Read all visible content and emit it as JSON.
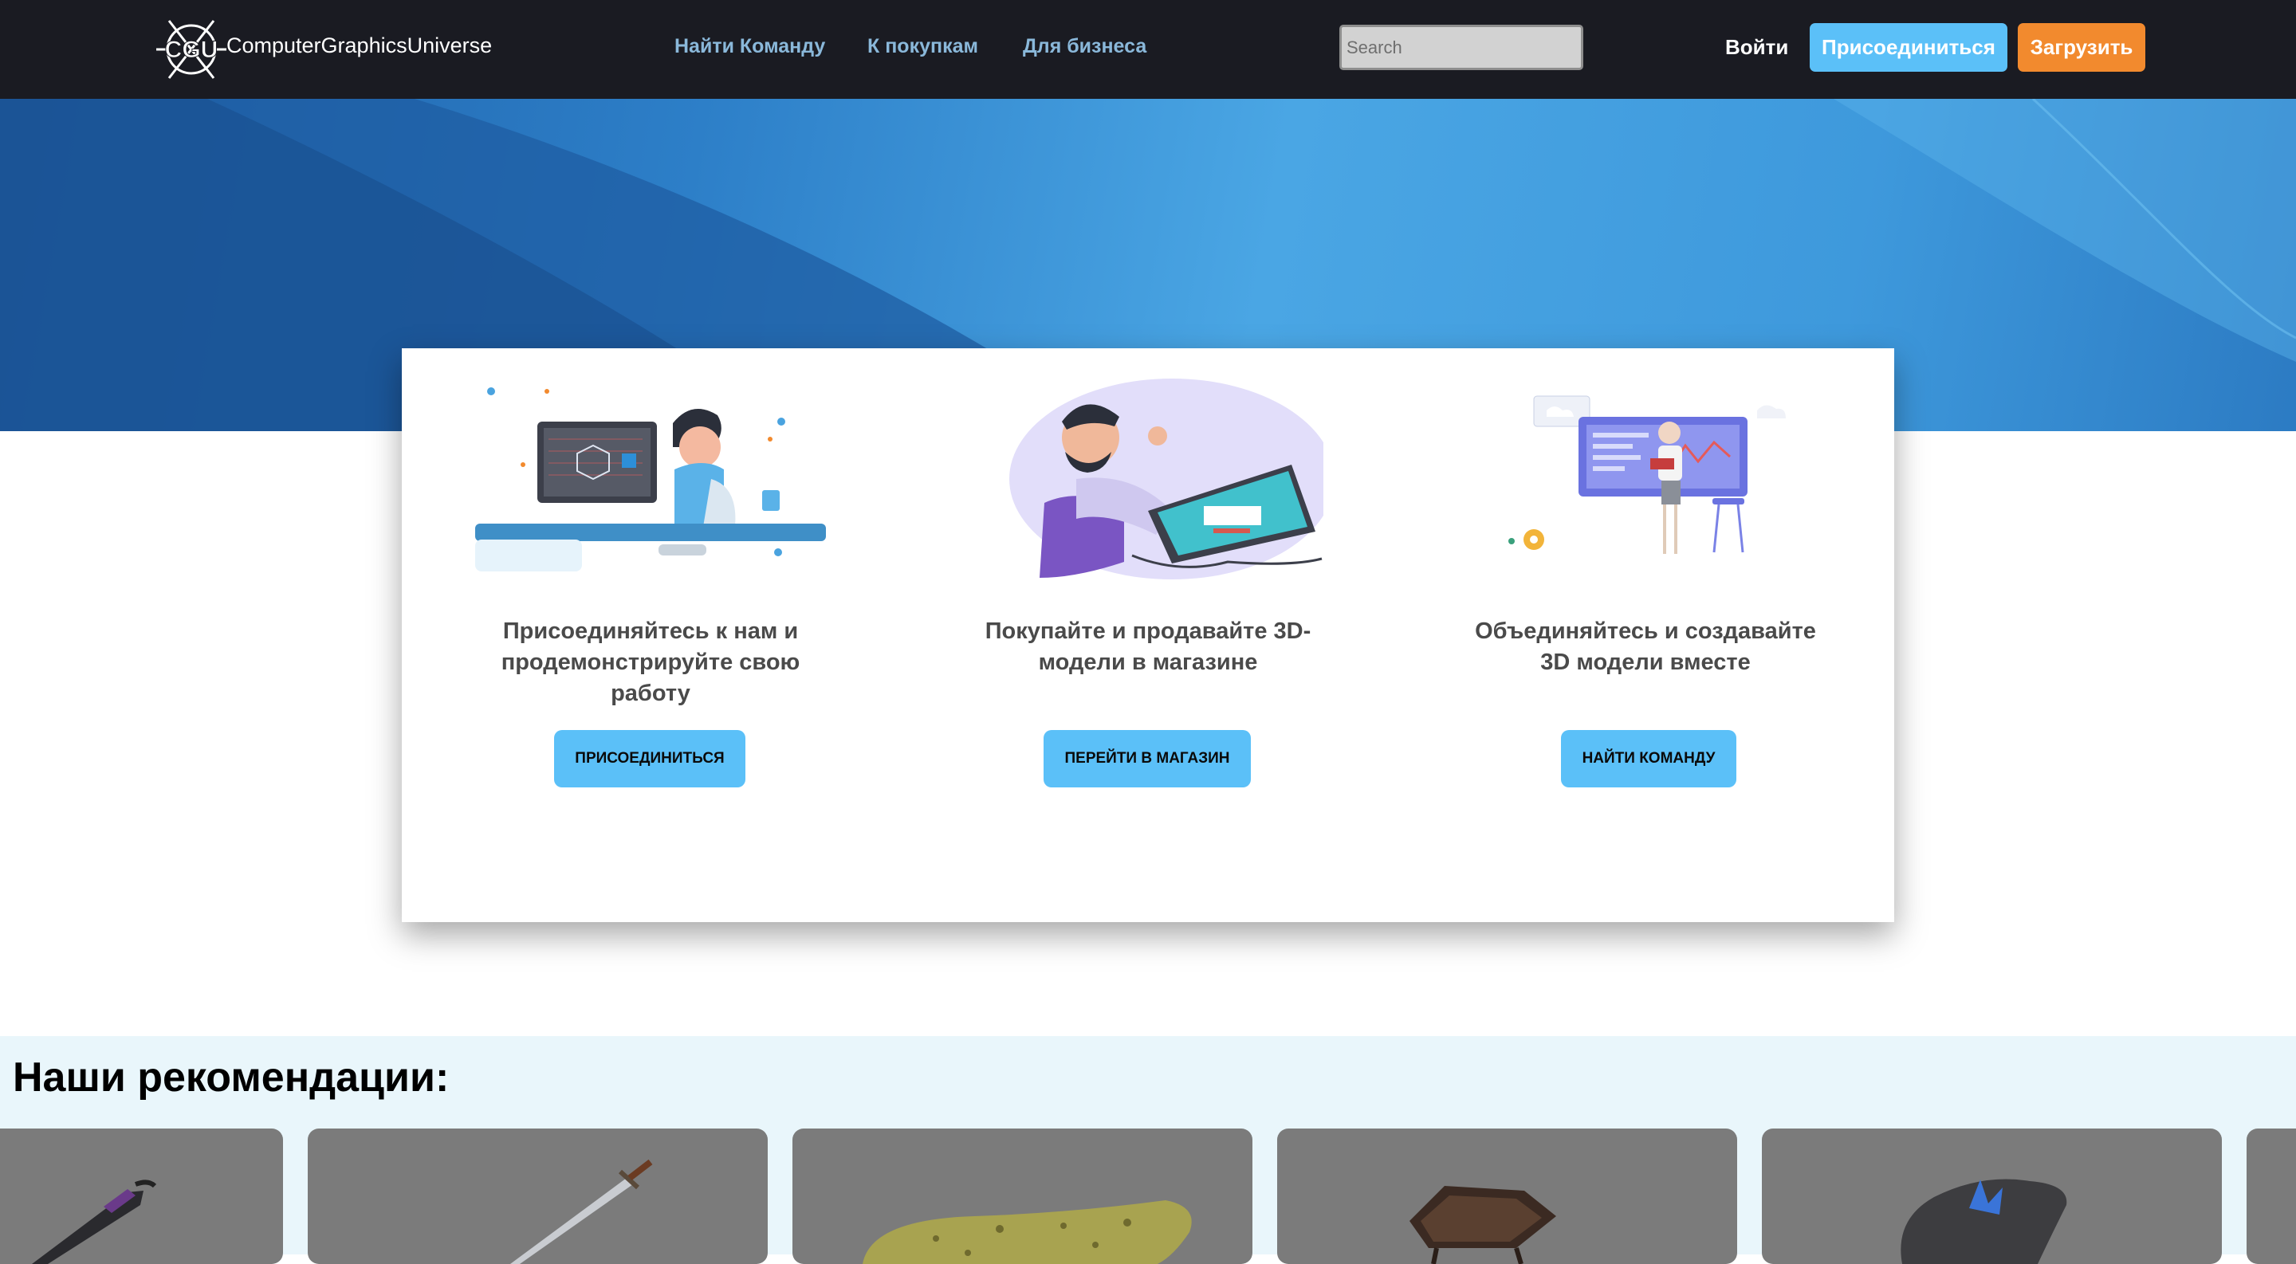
{
  "navbar": {
    "logo_text": "CGU",
    "brand": "ComputerGraphicsUniverse",
    "links": [
      "Найти Команду",
      "К покупкам",
      "Для бизнеса"
    ],
    "search_placeholder": "Search",
    "login": "Войти",
    "join": "Присоединиться",
    "upload": "Загрузить"
  },
  "features": [
    {
      "text": "Присоединяйтесь к нам и продемонстрируйте свою работу",
      "button": "ПРИСОЕДИНИТЬСЯ",
      "illustration": "person-at-computer-illustration"
    },
    {
      "text": "Покупайте и продавайте 3D-модели в магазине",
      "button": "ПЕРЕЙТИ В МАГАЗИН",
      "illustration": "man-with-tablet-illustration"
    },
    {
      "text": "Объединяйтесь и создавайте 3D модели вместе",
      "button": "НАЙТИ КОМАНДУ",
      "illustration": "team-dashboard-illustration"
    }
  ],
  "recommendations": {
    "title": "Наши рекомендации:",
    "items": [
      "dark-sword-model",
      "longsword-model",
      "pickle-model",
      "wheelbarrow-model",
      "crystal-rock-model"
    ]
  },
  "colors": {
    "navbar_bg": "#1a1b22",
    "link": "#8ab8da",
    "accent_blue": "#5bc0f8",
    "accent_orange": "#f28a2e",
    "recs_bg": "#e9f6fb"
  }
}
